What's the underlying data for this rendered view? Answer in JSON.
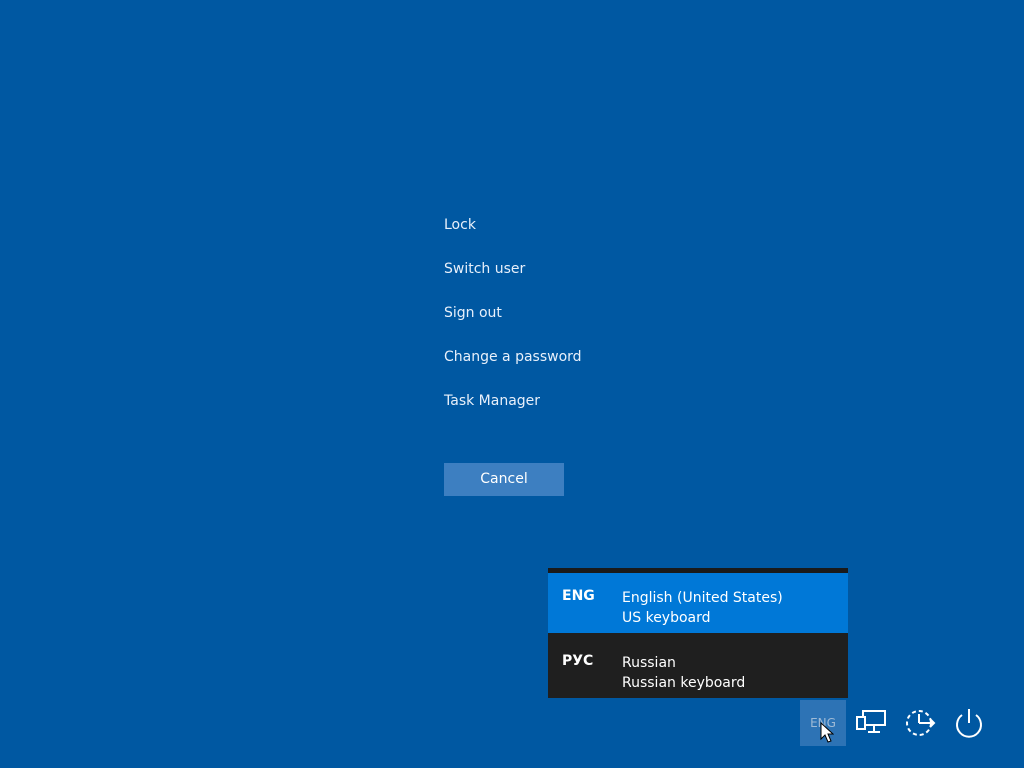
{
  "menu": {
    "items": [
      {
        "label": "Lock"
      },
      {
        "label": "Switch user"
      },
      {
        "label": "Sign out"
      },
      {
        "label": "Change a password"
      },
      {
        "label": "Task Manager"
      }
    ]
  },
  "cancel": {
    "label": "Cancel"
  },
  "language_popup": {
    "items": [
      {
        "code": "ENG",
        "name": "English (United States)",
        "layout": "US keyboard",
        "selected": true
      },
      {
        "code": "РУС",
        "name": "Russian",
        "layout": "Russian keyboard",
        "selected": false
      }
    ]
  },
  "tray": {
    "language_indicator": "ENG",
    "icons": [
      "network-icon",
      "ease-of-access-icon",
      "power-icon"
    ]
  },
  "colors": {
    "background": "#0058a2",
    "accent": "#0078d7",
    "popup_background": "#1f1f1f",
    "button": "#3d7fc1"
  }
}
